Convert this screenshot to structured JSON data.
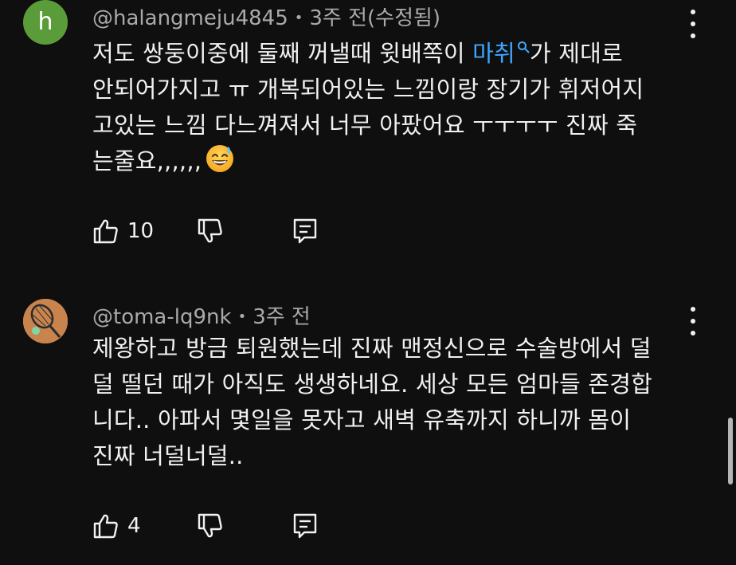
{
  "comments": [
    {
      "avatar_letter": "h",
      "avatar_color": "#5a9c3a",
      "handle": "@halangmeju4845",
      "time": "3주 전(수정됨)",
      "lines": [
        {
          "before": "저도 쌍둥이중에 둘째 꺼낼때 윗배쪽이 ",
          "link": "마취",
          "after": "가 제대로"
        },
        {
          "text": "안되어가지고 ㅠ 개복되어있는 느낌이랑 장기가 휘저어지"
        },
        {
          "text": "고있는 느낌 다느껴져서 너무 아팠어요 ㅜㅜㅜㅜ 진짜 죽"
        },
        {
          "text": "는줄요,,,,,,"
        }
      ],
      "emoji": "sweat-smile-emoji",
      "likes": "10"
    },
    {
      "avatar_icon": "tennis-racket-icon",
      "avatar_color": "#c9844e",
      "handle": "@toma-lq9nk",
      "time": "3주 전",
      "lines": [
        {
          "text": "제왕하고 방금 퇴원했는데 진짜 맨정신으로 수술방에서 덜"
        },
        {
          "text": "덜 떨던 때가 아직도 생생하네요. 세상 모든 엄마들 존경합"
        },
        {
          "text": "니다.. 아파서 몇일을 못자고 새벽 유축까지 하니까 몸이"
        },
        {
          "text": "진짜 너덜너덜.."
        }
      ],
      "likes": "4"
    }
  ],
  "colors": {
    "background": "#0f0f0f",
    "text": "#f1f1f1",
    "secondary": "#aaaaaa",
    "link": "#3ea6ff"
  },
  "icons": {
    "like": "thumbs-up-icon",
    "dislike": "thumbs-down-icon",
    "reply": "reply-comment-icon",
    "menu": "more-vert-icon",
    "search": "search-icon"
  }
}
